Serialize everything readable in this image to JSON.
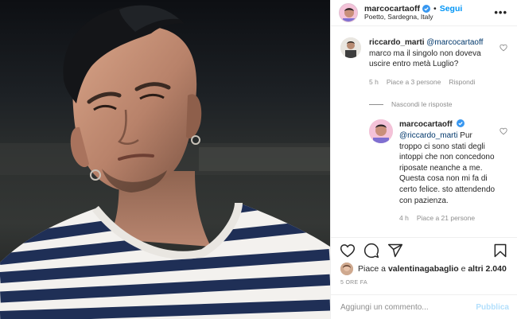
{
  "post": {
    "username": "marcocartaoff",
    "follow_label": "Segui",
    "separator": "•",
    "location": "Poetto, Sardegna, Italy",
    "more_label": "•••"
  },
  "comments": [
    {
      "username": "riccardo_marti",
      "mention": "@marcocartaoff",
      "text": "marco ma il singolo non doveva uscire entro metà Luglio?",
      "time": "5 h",
      "likes": "Piace a 3 persone",
      "reply_label": "Rispondi"
    }
  ],
  "hide_replies_label": "Nascondi le risposte",
  "reply": {
    "username": "marcocartaoff",
    "mention": "@riccardo_marti",
    "text": "Pur troppo ci sono stati degli intoppi che non concedono riposate neanche a me. Questa cosa non mi fa di certo felice. sto attendendo con pazienza.",
    "time": "4 h",
    "likes": "Piace a 21 persone"
  },
  "likes_line": {
    "prefix": "Piace a",
    "user": "valentinagabaglio",
    "middle": "e",
    "others": "altri 2.040"
  },
  "time_ago": "5 ORE FA",
  "comment_input": {
    "placeholder": "Aggiungi un commento...",
    "value": ""
  },
  "publish_label": "Pubblica",
  "colors": {
    "link_blue": "#0095f6",
    "mention_blue": "#00376b",
    "publish_disabled": "#b2dffc",
    "muted_text": "#8e8e8e"
  },
  "icons": [
    "verified-badge-icon",
    "heart-icon",
    "comment-icon",
    "share-icon",
    "bookmark-icon",
    "more-options-icon"
  ]
}
